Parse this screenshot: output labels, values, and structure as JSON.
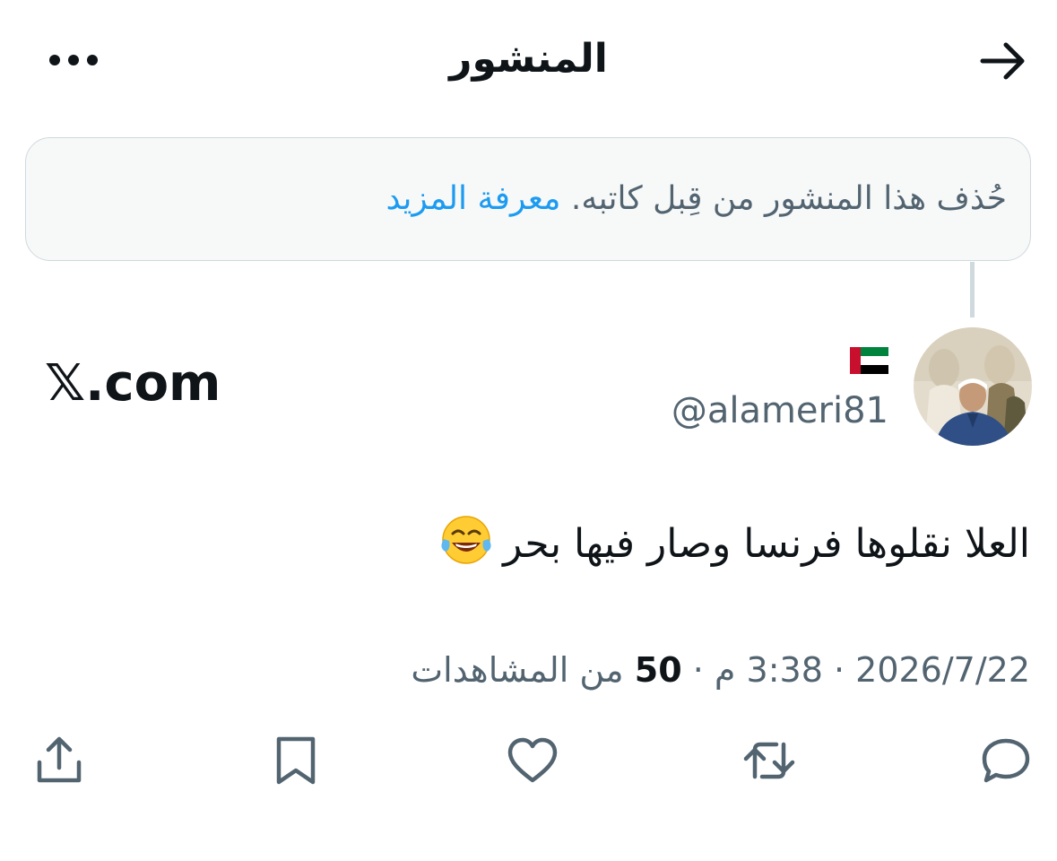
{
  "header": {
    "title": "المنشور",
    "back_icon": "arrow-right-icon",
    "more_icon": "more-dots-icon"
  },
  "notice": {
    "text": "حُذف هذا المنشور من قِبل كاتبه.",
    "link": "معرفة المزيد"
  },
  "author": {
    "handle": "@alameri81",
    "flag_icon": "uae-flag-icon"
  },
  "watermark": "𝕏.com",
  "post": {
    "text": "العلا نقلوها فرنسا وصار فيها بحر",
    "emoji": "face-with-tears-of-joy-icon"
  },
  "meta": {
    "date": "2026/7/22",
    "time": "3:38 م",
    "separator": "·",
    "views_count": "50",
    "views_label": "من المشاهدات"
  },
  "actions": [
    {
      "name": "reply",
      "icon": "reply-icon"
    },
    {
      "name": "repost",
      "icon": "repost-icon"
    },
    {
      "name": "like",
      "icon": "heart-icon"
    },
    {
      "name": "bookmark",
      "icon": "bookmark-icon"
    },
    {
      "name": "share",
      "icon": "share-icon"
    }
  ],
  "colors": {
    "text": "#0f1419",
    "secondary": "#536471",
    "link": "#1d9bf0",
    "notice_bg": "#f7f9f9",
    "border": "#cfd9de"
  }
}
